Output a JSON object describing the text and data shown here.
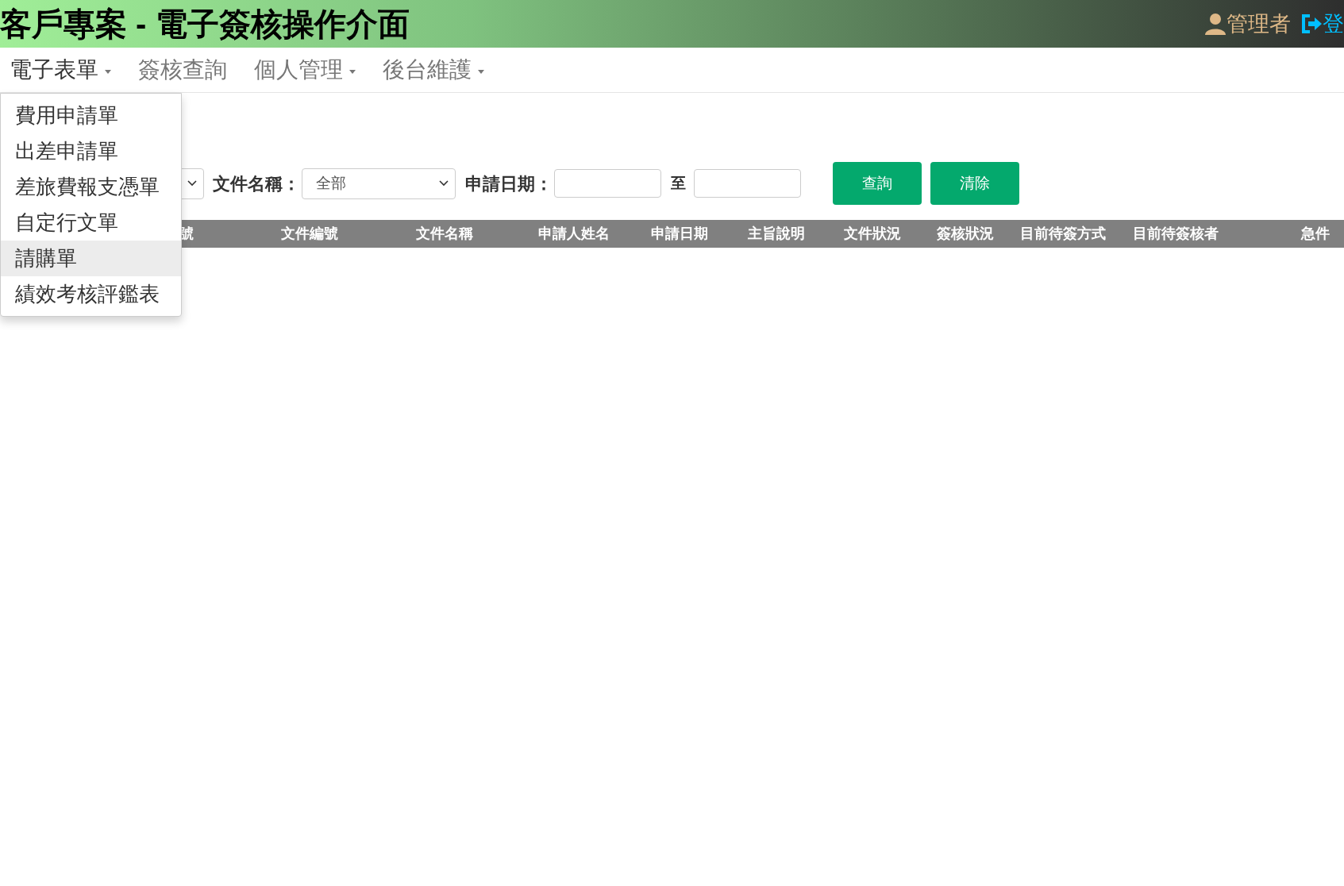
{
  "header": {
    "title": "客戶專案 - 電子簽核操作介面",
    "user": "管理者",
    "logout": "登"
  },
  "nav": [
    {
      "label": "電子表單",
      "dropdown": true,
      "open": true
    },
    {
      "label": "簽核查詢",
      "dropdown": false,
      "open": false
    },
    {
      "label": "個人管理",
      "dropdown": true,
      "open": false
    },
    {
      "label": "後台維護",
      "dropdown": true,
      "open": false
    }
  ],
  "menu": [
    {
      "label": "費用申請單",
      "selected": false
    },
    {
      "label": "出差申請單",
      "selected": false
    },
    {
      "label": "差旅費報支憑單",
      "selected": false
    },
    {
      "label": "自定行文單",
      "selected": false
    },
    {
      "label": "請購單",
      "selected": true
    },
    {
      "label": "績效考核評鑑表",
      "selected": false
    }
  ],
  "filters": {
    "doc_name_label": "文件名稱：",
    "doc_name_value": "全部",
    "date_label": "申請日期：",
    "date_to": "至"
  },
  "buttons": [
    {
      "label": "查詢"
    },
    {
      "label": "清除"
    }
  ],
  "table": {
    "columns": [
      "號",
      "文件編號",
      "文件名稱",
      "申請人姓名",
      "申請日期",
      "主旨說明",
      "文件狀況",
      "簽核狀況",
      "目前待簽方式",
      "目前待簽核者",
      "急件"
    ]
  }
}
